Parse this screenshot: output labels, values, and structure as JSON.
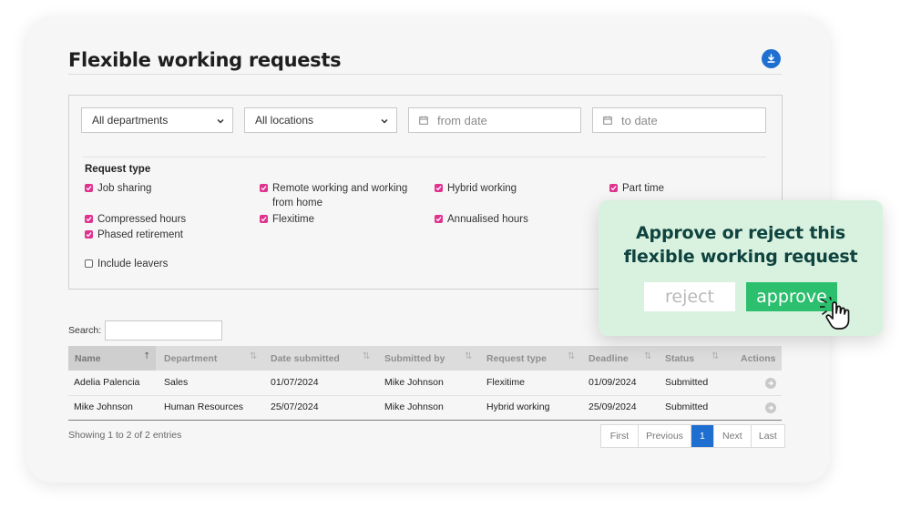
{
  "page": {
    "title": "Flexible working requests",
    "download_icon": "download-icon"
  },
  "filters": {
    "department": {
      "selected": "All departments"
    },
    "location": {
      "selected": "All locations"
    },
    "from_date": {
      "placeholder": "from date"
    },
    "to_date": {
      "placeholder": "to date"
    },
    "request_type_label": "Request type",
    "request_types": [
      {
        "label": "Job sharing",
        "checked": true
      },
      {
        "label": "Remote working and working from home",
        "checked": true
      },
      {
        "label": "Hybrid working",
        "checked": true
      },
      {
        "label": "Part time",
        "checked": true
      },
      {
        "label": "Compressed hours",
        "checked": true
      },
      {
        "label": "Flexitime",
        "checked": true
      },
      {
        "label": "Annualised hours",
        "checked": true
      },
      {
        "label": "Phased retirement",
        "checked": true
      }
    ],
    "include_leavers": {
      "label": "Include leavers",
      "checked": false
    }
  },
  "search": {
    "label": "Search:",
    "value": ""
  },
  "table": {
    "columns": [
      "Name",
      "Department",
      "Date submitted",
      "Submitted by",
      "Request type",
      "Deadline",
      "Status",
      "Actions"
    ],
    "rows": [
      {
        "name": "Adelia Palencia",
        "department": "Sales",
        "date_submitted": "01/07/2024",
        "submitted_by": "Mike Johnson",
        "request_type": "Flexitime",
        "deadline": "01/09/2024",
        "status": "Submitted"
      },
      {
        "name": "Mike Johnson",
        "department": "Human Resources",
        "date_submitted": "25/07/2024",
        "submitted_by": "Mike Johnson",
        "request_type": "Hybrid working",
        "deadline": "25/09/2024",
        "status": "Submitted"
      }
    ],
    "showing": "Showing 1 to 2 of 2 entries"
  },
  "pagination": {
    "first": "First",
    "previous": "Previous",
    "current": "1",
    "next": "Next",
    "last": "Last"
  },
  "popup": {
    "title_line1": "Approve or reject this",
    "title_line2": "flexible working request",
    "reject": "reject",
    "approve": "approve"
  },
  "colors": {
    "accent_blue": "#1f6fd1",
    "checkbox_pink": "#e0338f",
    "approve_green": "#2cbf6e",
    "popup_bg": "#d9f2df",
    "popup_title": "#0f4340"
  }
}
